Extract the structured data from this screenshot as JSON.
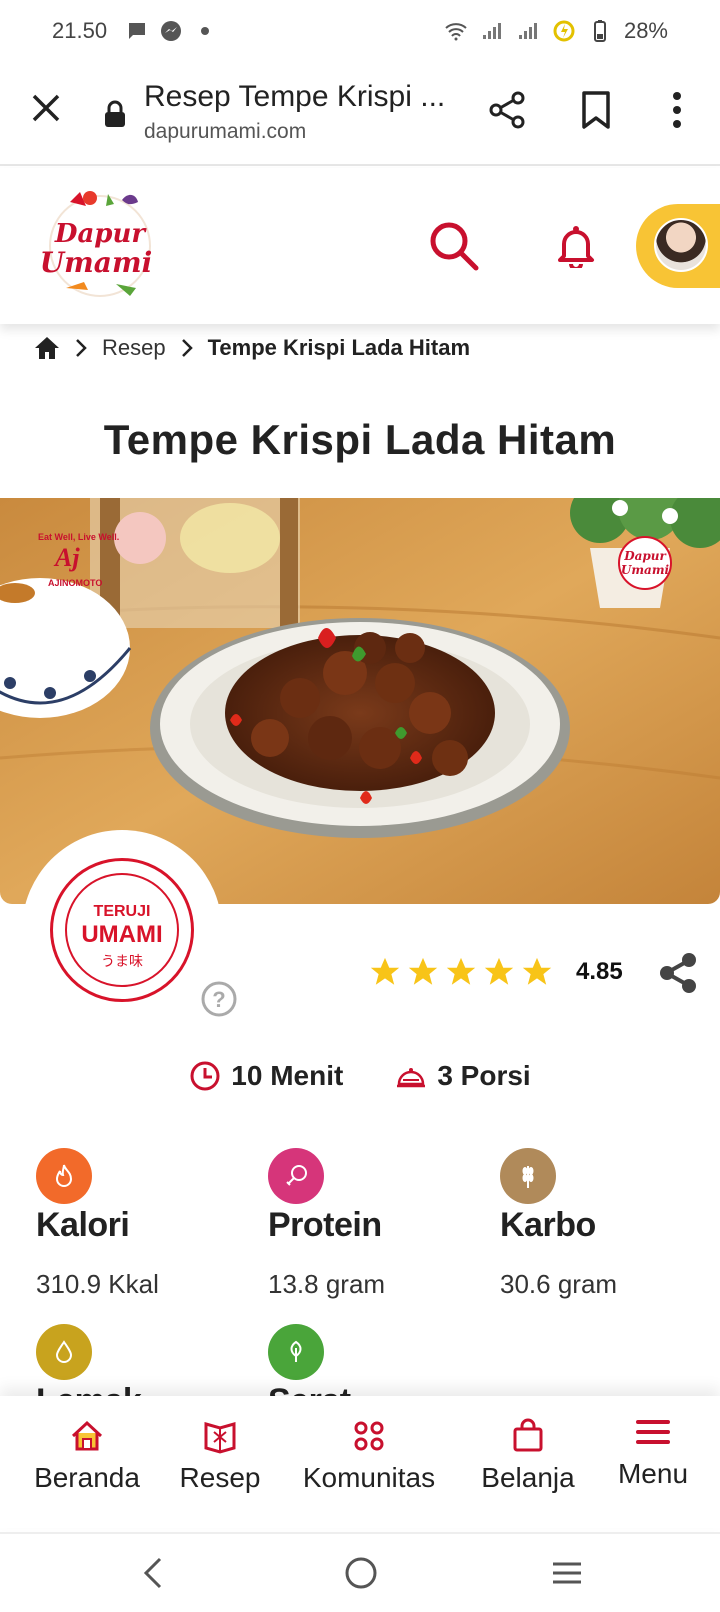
{
  "status_bar": {
    "time": "21.50",
    "battery": "28%"
  },
  "browser": {
    "title": "Resep Tempe Krispi ...",
    "url": "dapurumami.com"
  },
  "header": {
    "logo_text_top": "Dapur",
    "logo_text_bottom": "Umami"
  },
  "breadcrumb": {
    "item1": "Resep",
    "current": "Tempe Krispi Lada Hitam"
  },
  "recipe": {
    "title": "Tempe Krispi Lada Hitam",
    "hero_brand": "AJINOMOTO",
    "hero_tagline": "Eat Well, Live Well.",
    "badge_top": "TERUJI",
    "badge_main": "UMAMI",
    "badge_sub": "うま味",
    "rating": "4.85",
    "time": "10 Menit",
    "portions": "3 Porsi"
  },
  "nutrition": [
    {
      "name": "Kalori",
      "value": "310.9 Kkal",
      "color": "#f26a2a",
      "icon": "flame-icon"
    },
    {
      "name": "Protein",
      "value": "13.8 gram",
      "color": "#d6357a",
      "icon": "drumstick-icon"
    },
    {
      "name": "Karbo",
      "value": "30.6 gram",
      "color": "#b08a5a",
      "icon": "wheat-icon"
    },
    {
      "name": "Lemak",
      "value": "",
      "color": "#c8a31e",
      "icon": "drop-icon"
    },
    {
      "name": "Serat",
      "value": "",
      "color": "#4aa53a",
      "icon": "leaf-icon"
    }
  ],
  "bottom_nav": {
    "home": "Beranda",
    "recipe": "Resep",
    "community": "Komunitas",
    "shop": "Belanja",
    "menu": "Menu"
  },
  "colors": {
    "brand_red": "#c8102e",
    "accent_yellow": "#f8c435"
  }
}
